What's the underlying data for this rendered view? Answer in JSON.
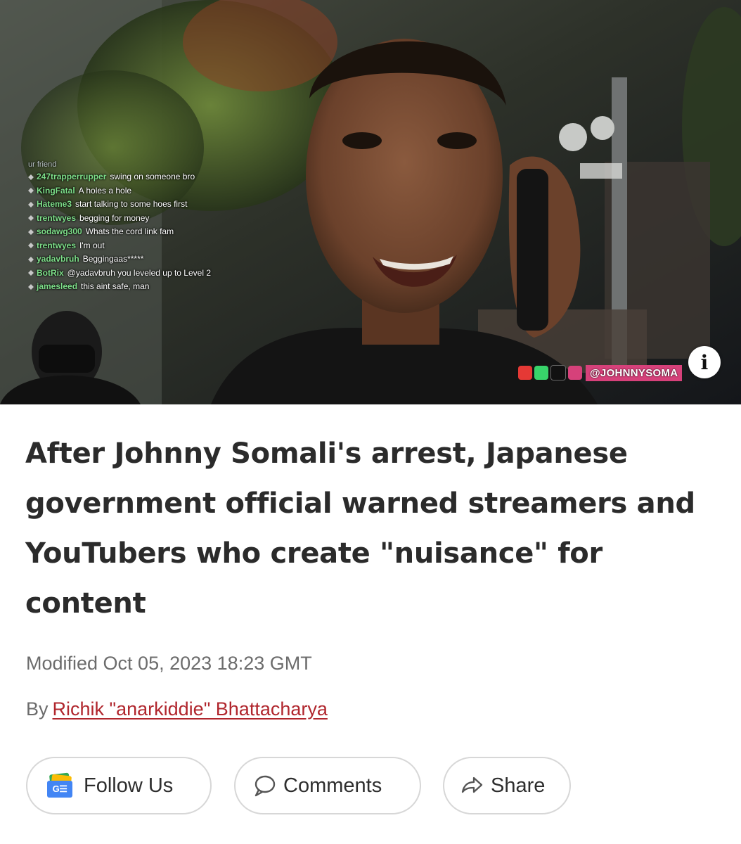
{
  "hero": {
    "chat": {
      "header": "ur friend",
      "lines": [
        {
          "user": "247trapperrupper",
          "msg": "swing on someone bro"
        },
        {
          "user": "KingFatal",
          "msg": "A holes a hole"
        },
        {
          "user": "Hateme3",
          "msg": "start talking to some hoes first"
        },
        {
          "user": "trentwyes",
          "msg": "begging for money"
        },
        {
          "user": "sodawg300",
          "msg": "Whats the cord link fam"
        },
        {
          "user": "trentwyes",
          "msg": "I'm out"
        },
        {
          "user": "yadavbruh",
          "msg": "Beggingaas*****"
        },
        {
          "user": "BotRix",
          "msg": "@yadavbruh you leveled up to Level 2"
        },
        {
          "user": "jamesleed",
          "msg": "this aint safe, man"
        }
      ]
    },
    "watermark_handle": "@JOHNNYSOMA",
    "info_icon": "i",
    "colors": {
      "chat_user": "#7ee08a",
      "handle_bg": "#d6417a"
    }
  },
  "article": {
    "headline": "After Johnny Somali's arrest, Japanese government official warned streamers and YouTubers who create \"nuisance\" for content",
    "modified": "Modified Oct 05, 2023 18:23 GMT",
    "by_label": "By",
    "author": "Richik \"anarkiddie\" Bhattacharya",
    "author_color": "#b0262d"
  },
  "actions": {
    "follow_label": "Follow Us",
    "follow_icon_text": "G☰",
    "comments_label": "Comments",
    "share_label": "Share"
  }
}
